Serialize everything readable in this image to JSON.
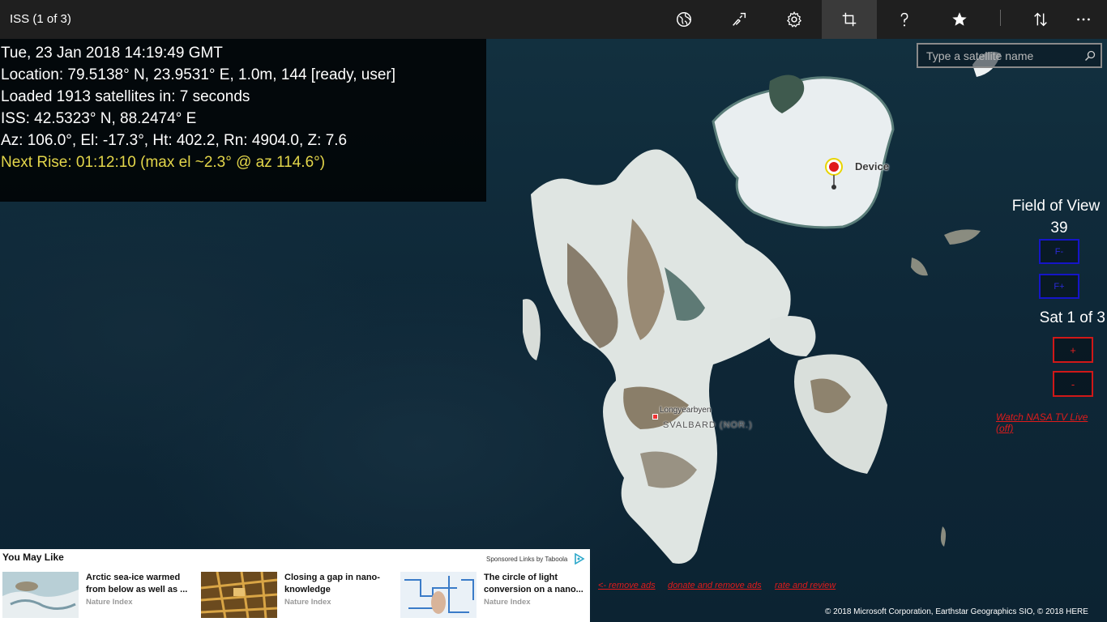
{
  "app": {
    "title": "ISS (1 of 3)"
  },
  "toolbar": {
    "buttons": [
      {
        "icon": "globe-icon"
      },
      {
        "icon": "track-icon"
      },
      {
        "icon": "gear-icon"
      },
      {
        "icon": "crop-icon",
        "active": true
      },
      {
        "icon": "help-icon"
      },
      {
        "icon": "star-icon"
      },
      {
        "icon": "sort-icon"
      },
      {
        "icon": "more-icon"
      }
    ]
  },
  "info": {
    "datetime": "Tue, 23 Jan 2018 14:19:49 GMT",
    "location": "Location:  79.5138° N, 23.9531° E, 1.0m, 144 [ready, user]",
    "loaded": "Loaded 1913 satellites in: 7 seconds",
    "iss": "ISS:  42.5323° N, 88.2474° E",
    "azel": "Az:  106.0°, El: -17.3°, Ht: 402.2, Rn: 4904.0, Z: 7.6",
    "next_rise": "Next Rise:  01:12:10 (max el ~2.3° @ az 114.6°)"
  },
  "search": {
    "placeholder": "Type a satellite name"
  },
  "map": {
    "device_label": "Device",
    "town_label": "Longyearbyen",
    "region_label": "SVALBARD (NOR.)"
  },
  "controls": {
    "fov_title": "Field of View",
    "fov_value": "39",
    "fov_minus": "F-",
    "fov_plus": "F+",
    "sat_count": "Sat 1 of 3",
    "sat_plus": "+",
    "sat_minus": "-",
    "nasa_link": "Watch NASA TV Live (off)"
  },
  "ads": {
    "header": "You May Like",
    "sponsor": "Sponsored Links by Taboola",
    "items": [
      {
        "title": "Arctic sea-ice warmed from below as well as ...",
        "source": "Nature Index"
      },
      {
        "title": "Closing a gap in nano-knowledge",
        "source": "Nature Index"
      },
      {
        "title": "The circle of light conversion on a nano...",
        "source": "Nature Index"
      }
    ]
  },
  "footer_links": {
    "remove_ads": "<- remove ads",
    "donate": "donate and remove ads",
    "rate": "rate and review"
  },
  "copyright": "© 2018 Microsoft Corporation, Earthstar Geographics  SIO, © 2018 HERE"
}
